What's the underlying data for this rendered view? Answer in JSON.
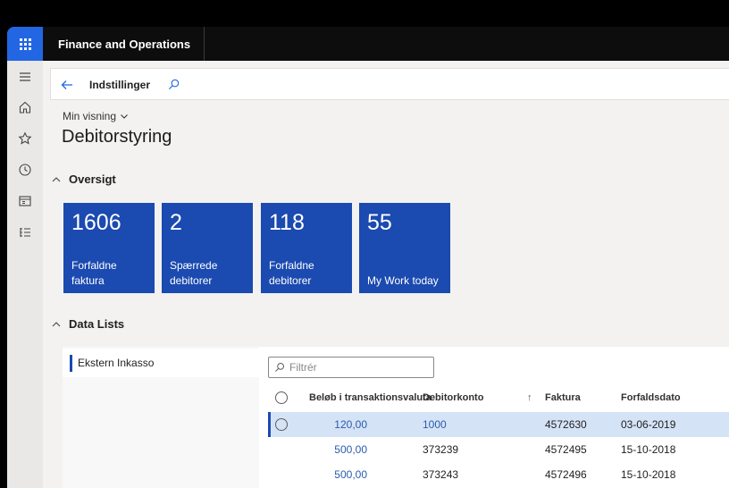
{
  "app": {
    "title": "Finance and Operations"
  },
  "nav": {
    "items": [
      {
        "icon": "hamburger-icon"
      },
      {
        "icon": "home-icon"
      },
      {
        "icon": "star-icon"
      },
      {
        "icon": "clock-icon"
      },
      {
        "icon": "workspace-icon"
      },
      {
        "icon": "modules-list-icon"
      }
    ]
  },
  "header": {
    "breadcrumb": "Indstillinger"
  },
  "view": {
    "label": "Min visning"
  },
  "page": {
    "title": "Debitorstyring"
  },
  "overview": {
    "heading": "Oversigt",
    "tiles": [
      {
        "count": "1606",
        "label": "Forfaldne faktura"
      },
      {
        "count": "2",
        "label": "Spærrede debitorer"
      },
      {
        "count": "118",
        "label": "Forfaldne debitorer"
      },
      {
        "count": "55",
        "label": "My Work today"
      }
    ]
  },
  "data_lists": {
    "heading": "Data Lists",
    "items": [
      {
        "label": "Ekstern Inkasso"
      }
    ],
    "filter_placeholder": "Filtrér",
    "columns": [
      "Beløb i transaktionsvaluta",
      "Debitorkonto",
      "Faktura",
      "Forfaldsdato"
    ],
    "rows": [
      {
        "amount": "120,00",
        "account": "1000",
        "invoice": "4572630",
        "due": "03-06-2019",
        "selected": true
      },
      {
        "amount": "500,00",
        "account": "373239",
        "invoice": "4572495",
        "due": "15-10-2018",
        "selected": false
      },
      {
        "amount": "500,00",
        "account": "373243",
        "invoice": "4572496",
        "due": "15-10-2018",
        "selected": false
      }
    ]
  },
  "colors": {
    "accent": "#2266e3",
    "tile": "#1b4ab0",
    "selected_row": "#d5e3f7",
    "link": "#2a5caa"
  }
}
